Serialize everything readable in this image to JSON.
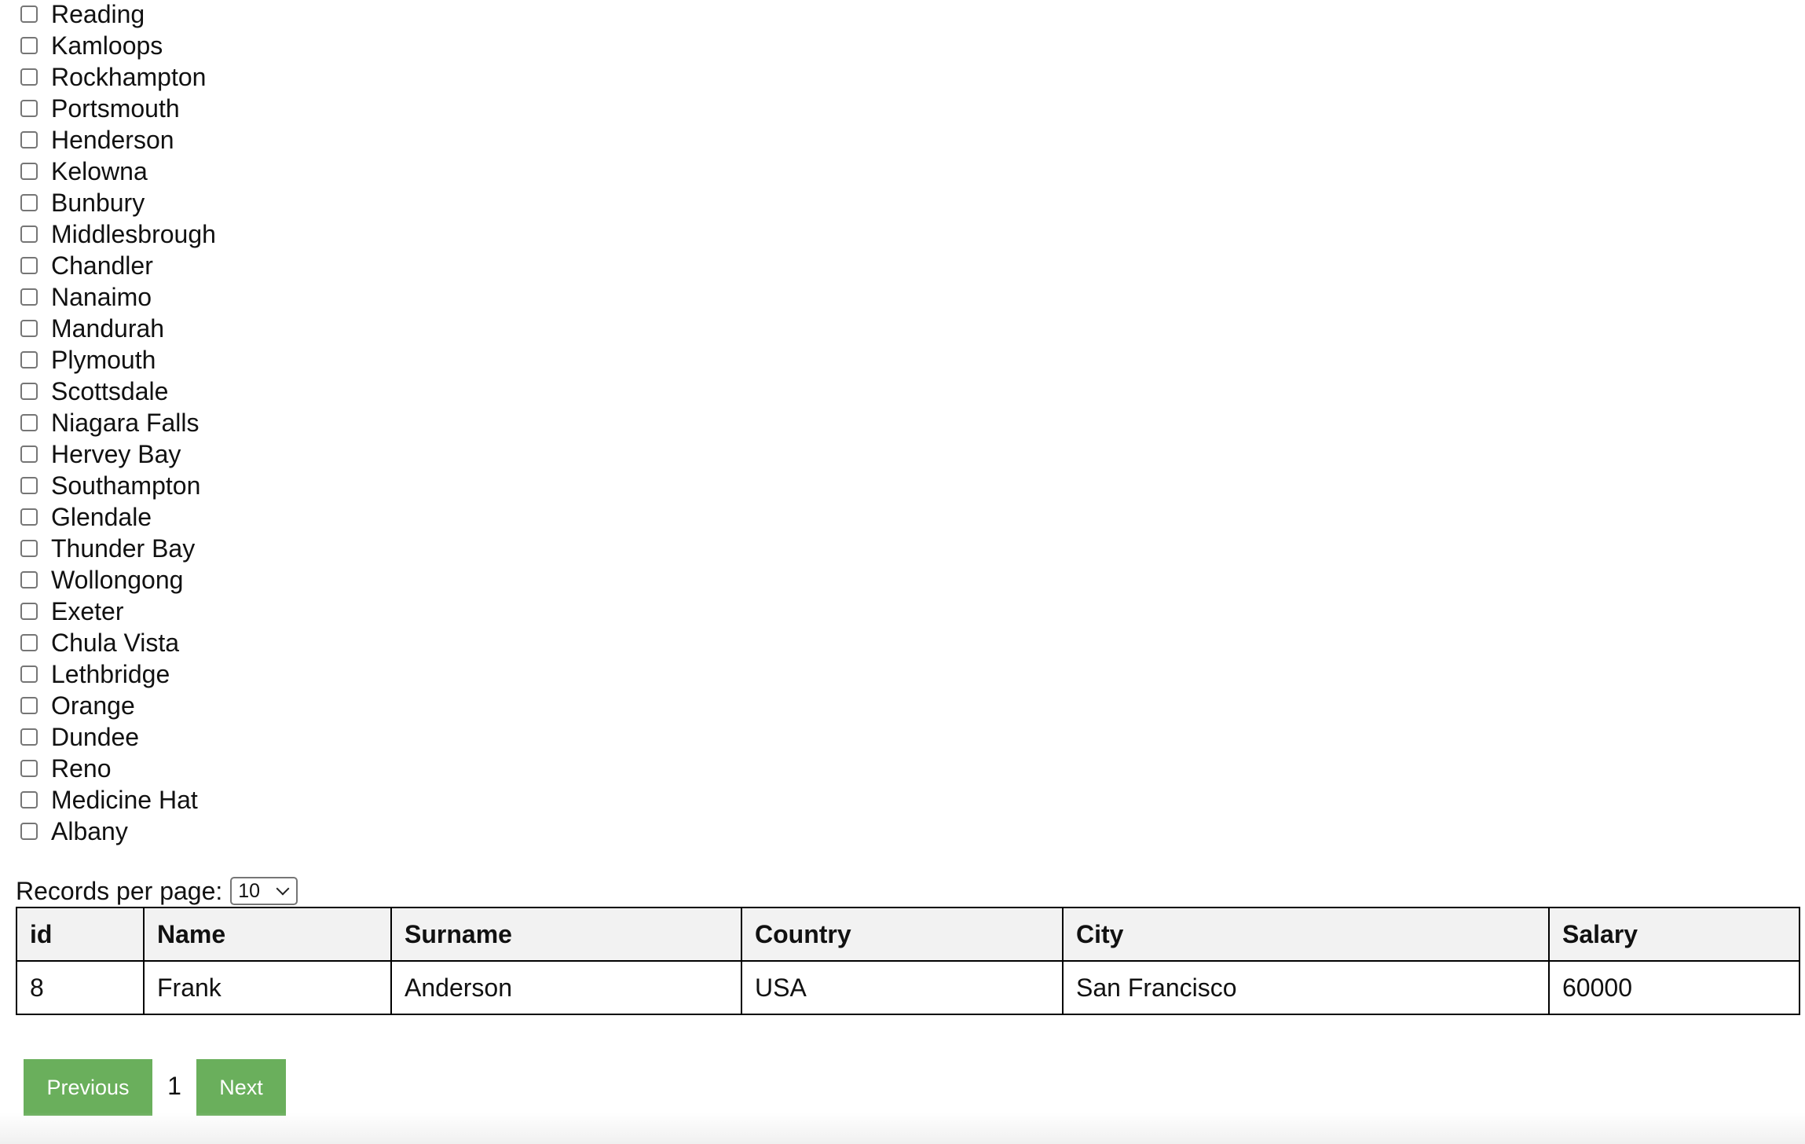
{
  "cities": [
    "Reading",
    "Kamloops",
    "Rockhampton",
    "Portsmouth",
    "Henderson",
    "Kelowna",
    "Bunbury",
    "Middlesbrough",
    "Chandler",
    "Nanaimo",
    "Mandurah",
    "Plymouth",
    "Scottsdale",
    "Niagara Falls",
    "Hervey Bay",
    "Southampton",
    "Glendale",
    "Thunder Bay",
    "Wollongong",
    "Exeter",
    "Chula Vista",
    "Lethbridge",
    "Orange",
    "Dundee",
    "Reno",
    "Medicine Hat",
    "Albany"
  ],
  "records": {
    "label": "Records per page:",
    "selected": "10"
  },
  "table": {
    "headers": [
      "id",
      "Name",
      "Surname",
      "Country",
      "City",
      "Salary"
    ],
    "rows": [
      [
        "8",
        "Frank",
        "Anderson",
        "USA",
        "San Francisco",
        "60000"
      ]
    ]
  },
  "pagination": {
    "previous_label": "Previous",
    "current_page": "1",
    "next_label": "Next"
  },
  "colors": {
    "button_green": "#6aaf5c",
    "header_gray": "#f2f2f2",
    "border": "#000000"
  }
}
